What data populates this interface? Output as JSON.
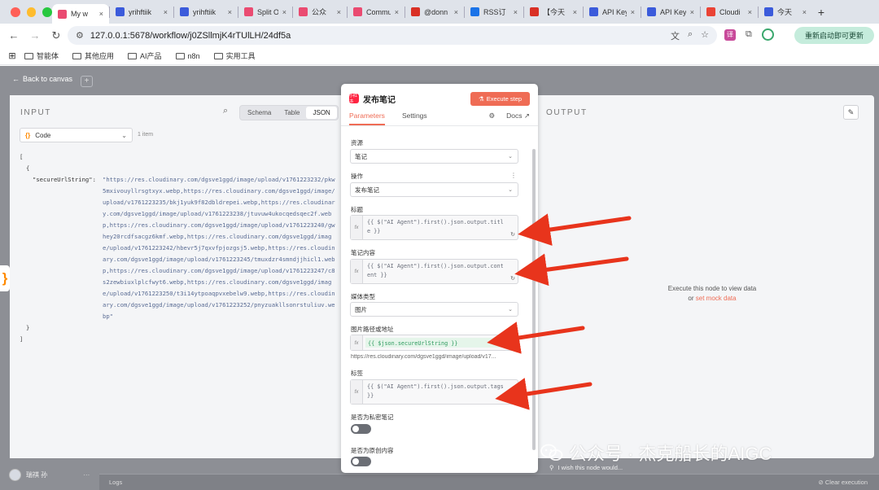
{
  "browser": {
    "tabs": [
      {
        "label": "My w",
        "color": "#ea4b71"
      },
      {
        "label": "yrihftiik",
        "color": "#3b5bdb"
      },
      {
        "label": "yrihftiik",
        "color": "#3b5bdb"
      },
      {
        "label": "Split Ou",
        "color": "#ea4b71"
      },
      {
        "label": "公众",
        "color": "#ea4b71"
      },
      {
        "label": "Commu",
        "color": "#ea4b71"
      },
      {
        "label": "@donn",
        "color": "#d93025"
      },
      {
        "label": "RSS订",
        "color": "#1a73e8"
      },
      {
        "label": "【今天",
        "color": "#d93025"
      },
      {
        "label": "API Key",
        "color": "#3b5bdb"
      },
      {
        "label": "API Key",
        "color": "#3b5bdb"
      },
      {
        "label": "Cloudi",
        "color": "#ea4335"
      },
      {
        "label": "今天",
        "color": "#3b5bdb"
      }
    ],
    "new_tab": "+",
    "url": "127.0.0.1:5678/workflow/j0ZSllmjK4rTUlLH/24df5a",
    "restart_label": "重新启动即可更新",
    "bookmarks": [
      "智能体",
      "其他应用",
      "AI产品",
      "n8n",
      "实用工具"
    ]
  },
  "canvas": {
    "back_label": "Back to canvas",
    "user_name": "瑞祺 孙",
    "user_menu": "···",
    "logs_label": "Logs",
    "clear_execution": "Clear execution",
    "wish_text": "I wish this node would..."
  },
  "input_panel": {
    "title": "INPUT",
    "view_modes": [
      "Schema",
      "Table",
      "JSON"
    ],
    "active_view": "JSON",
    "code_dropdown": "Code",
    "item_count": "1 item",
    "json_open": "[",
    "json_obj_open": "{",
    "json_key": "\"secureUrlString\":",
    "json_value": "\"https://res.cloudinary.com/dgsve1ggd/image/upload/v1761223232/pkw5mxivouyllrsgtxyx.webp,https://res.cloudinary.com/dgsve1ggd/image/upload/v1761223235/bkj1yuk9f82dbldrepei.webp,https://res.cloudinary.com/dgsve1ggd/image/upload/v1761223238/jtuvuw4ukocqedsqec2f.webp,https://res.cloudinary.com/dgsve1ggd/image/upload/v1761223240/gwhey20rcdfsacgz6kmf.webp,https://res.cloudinary.com/dgsve1ggd/image/upload/v1761223242/hbevr5j7qxvfpjozgsj5.webp,https://res.cloudinary.com/dgsve1ggd/image/upload/v1761223245/tmuxdzr4smndjjhicl1.webp,https://res.cloudinary.com/dgsve1ggd/image/upload/v1761223247/c8s2zewbiuxlplcfwyt6.webp,https://res.cloudinary.com/dgsve1ggd/image/upload/v1761223250/t3i14ytpoaqpvxebelw9.webp,https://res.cloudinary.com/dgsve1ggd/image/upload/v1761223252/pnyzuakllsonrstuliuv.webp\"",
    "json_obj_close": "}",
    "json_close": "]"
  },
  "node_panel": {
    "title": "发布笔记",
    "icon_text": "小红书",
    "execute_label": "Execute step",
    "tabs": [
      "Parameters",
      "Settings"
    ],
    "docs_label": "Docs",
    "fields": {
      "resource_label": "资源",
      "resource_value": "笔记",
      "operation_label": "操作",
      "operation_value": "发布笔记",
      "title_label": "标题",
      "title_expr": "{{ $(\"AI Agent\").first().json.output.title }}",
      "content_label": "笔记内容",
      "content_expr": "{{ $(\"AI Agent\").first().json.output.content }}",
      "media_label": "媒体类型",
      "media_value": "图片",
      "image_label": "图片路径或地址",
      "image_expr": "{{ $json.secureUrlString }}",
      "image_result": "https://res.cloudinary.com/dgsve1ggd/image/upload/v17...",
      "tags_label": "标签",
      "tags_expr": "{{ $(\"AI Agent\").first().json.output.tags }}",
      "private_label": "是否为私密笔记",
      "private_value": 0,
      "original_label": "是否为原创内容",
      "original_value": 0
    }
  },
  "output_panel": {
    "title": "OUTPUT",
    "message": "Execute this node to view data",
    "or_text": "or",
    "mock_link": "set mock data"
  },
  "watermark": {
    "text": "公众号 · 杰克船长的AIGC"
  },
  "colors": {
    "accent": "#ef6c55",
    "xhs_red": "#ff2442",
    "arrow_red": "#e8341c"
  }
}
